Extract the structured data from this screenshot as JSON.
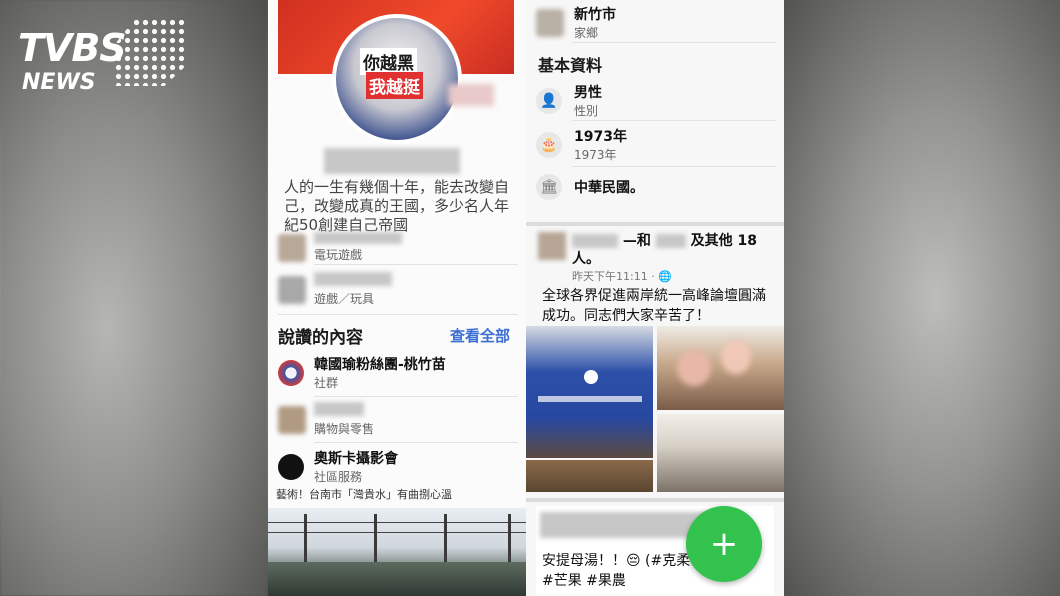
{
  "logo": {
    "brand": "TVBS",
    "sub": "NEWS"
  },
  "left": {
    "bio": "人的一生有幾個十年，能去改變自己，改變成真的王國，多少名人年紀50創建自己帝國",
    "pages": [
      {
        "category": "電玩遊戲"
      },
      {
        "category": "遊戲／玩具"
      }
    ],
    "liked_title": "說讚的內容",
    "see_all": "查看全部",
    "liked": [
      {
        "name": "韓國瑜粉絲團-桃竹苗",
        "category": "社群"
      },
      {
        "name": "",
        "category": "購物與零售"
      },
      {
        "name": "奧斯卡攝影會",
        "category": "社區服務"
      }
    ],
    "strip_text": "藝術！台南市「灣貴水」有曲捌心溫"
  },
  "right": {
    "city": "新竹市",
    "city_sub": "家鄉",
    "basic_title": "基本資料",
    "gender": "男性",
    "gender_sub": "性別",
    "birth": "1973年",
    "birth_sub": "1973年",
    "country": "中華民國。",
    "post_head_mid": "—和",
    "post_head_tail": "及其他 18",
    "post_head_line2": "人。",
    "post_time": "昨天下午11:11 · 🌐",
    "post_body": "全球各界促進兩岸統一高峰論壇圓滿成功。同志們大家辛苦了！",
    "bottom_post_line1": "安提母湯！！😔 (#克柔仙",
    "bottom_post_line2": "#芒果 #果農"
  },
  "fab_label": "+"
}
